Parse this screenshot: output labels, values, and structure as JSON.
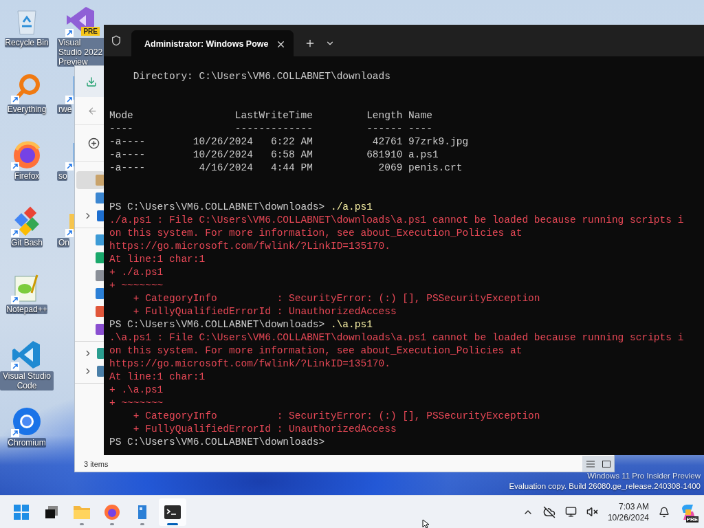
{
  "desktop_columns": [
    {
      "icons": [
        {
          "kind": "recycle-bin",
          "label": "Recycle Bin"
        },
        {
          "kind": "everything",
          "label": "Everything",
          "shortcut": true
        },
        {
          "kind": "firefox",
          "label": "Firefox",
          "shortcut": true
        },
        {
          "kind": "git",
          "label": "Git Bash",
          "shortcut": true
        },
        {
          "kind": "notepad",
          "label": "Notepad++",
          "shortcut": true
        },
        {
          "kind": "vscode",
          "label": "Visual Studio Code",
          "shortcut": true
        },
        {
          "kind": "chromium",
          "label": "Chromium",
          "shortcut": true
        }
      ]
    },
    {
      "icons": [
        {
          "kind": "vs-preview",
          "label": "Visual Studio 2022 Preview",
          "badge": "PRE",
          "shortcut": true
        },
        {
          "kind": "figure",
          "label": "rwe",
          "shortcut": true
        },
        {
          "kind": "figure",
          "label": "so",
          "shortcut": true
        },
        {
          "kind": "folder",
          "label": "On",
          "shortcut": true
        }
      ]
    }
  ],
  "explorer": {
    "sidebar_groups": [
      {
        "items": [
          {
            "kind": "home",
            "selected": true,
            "expandable": false
          },
          {
            "kind": "gallery",
            "selected": false,
            "expandable": false
          },
          {
            "kind": "cloud",
            "selected": false,
            "expandable": true
          }
        ]
      },
      {
        "items": [
          {
            "kind": "desktop",
            "selected": false,
            "expandable": false
          },
          {
            "kind": "downloads",
            "selected": false,
            "expandable": false
          },
          {
            "kind": "documents",
            "selected": false,
            "expandable": false
          },
          {
            "kind": "pictures",
            "selected": false,
            "expandable": false
          },
          {
            "kind": "music",
            "selected": false,
            "expandable": false
          },
          {
            "kind": "videos",
            "selected": false,
            "expandable": false
          }
        ]
      },
      {
        "items": [
          {
            "kind": "this-pc",
            "selected": false,
            "expandable": true
          },
          {
            "kind": "network",
            "selected": false,
            "expandable": true
          }
        ]
      }
    ],
    "status": "3 items"
  },
  "terminal": {
    "tab_title": "Administrator: Windows Powe",
    "lines": [
      {
        "kind": "output",
        "text": "    Directory: C:\\Users\\VM6.COLLABNET\\downloads"
      },
      {
        "kind": "blank"
      },
      {
        "kind": "blank"
      },
      {
        "kind": "output",
        "text": "Mode                 LastWriteTime         Length Name"
      },
      {
        "kind": "output",
        "text": "----                 -------------         ------ ----"
      },
      {
        "kind": "output",
        "text": "-a----        10/26/2024   6:22 AM          42761 97zrk9.jpg"
      },
      {
        "kind": "output",
        "text": "-a----        10/26/2024   6:58 AM         681910 a.ps1"
      },
      {
        "kind": "output",
        "text": "-a----         4/16/2024   4:44 PM           2069 penis.crt"
      },
      {
        "kind": "blank"
      },
      {
        "kind": "blank"
      },
      {
        "kind": "prompt",
        "text": "PS C:\\Users\\VM6.COLLABNET\\downloads> ",
        "command": "./a.ps1"
      },
      {
        "kind": "error",
        "text": "./a.ps1 : File C:\\Users\\VM6.COLLABNET\\downloads\\a.ps1 cannot be loaded because running scripts i"
      },
      {
        "kind": "error",
        "text": "on this system. For more information, see about_Execution_Policies at"
      },
      {
        "kind": "error",
        "text": "https://go.microsoft.com/fwlink/?LinkID=135170."
      },
      {
        "kind": "error",
        "text": "At line:1 char:1"
      },
      {
        "kind": "error",
        "text": "+ ./a.ps1"
      },
      {
        "kind": "error",
        "text": "+ ~~~~~~~"
      },
      {
        "kind": "error",
        "text": "    + CategoryInfo          : SecurityError: (:) [], PSSecurityException"
      },
      {
        "kind": "error",
        "text": "    + FullyQualifiedErrorId : UnauthorizedAccess"
      },
      {
        "kind": "prompt",
        "text": "PS C:\\Users\\VM6.COLLABNET\\downloads> ",
        "command": ".\\a.ps1"
      },
      {
        "kind": "error",
        "text": ".\\a.ps1 : File C:\\Users\\VM6.COLLABNET\\downloads\\a.ps1 cannot be loaded because running scripts i"
      },
      {
        "kind": "error",
        "text": "on this system. For more information, see about_Execution_Policies at"
      },
      {
        "kind": "error",
        "text": "https://go.microsoft.com/fwlink/?LinkID=135170."
      },
      {
        "kind": "error",
        "text": "At line:1 char:1"
      },
      {
        "kind": "error",
        "text": "+ .\\a.ps1"
      },
      {
        "kind": "error",
        "text": "+ ~~~~~~~"
      },
      {
        "kind": "error",
        "text": "    + CategoryInfo          : SecurityError: (:) [], PSSecurityException"
      },
      {
        "kind": "error",
        "text": "    + FullyQualifiedErrorId : UnauthorizedAccess"
      },
      {
        "kind": "prompt",
        "text": "PS C:\\Users\\VM6.COLLABNET\\downloads> "
      }
    ]
  },
  "watermark": [
    "Windows 11 Pro Insider Preview",
    "Evaluation copy. Build 26080.ge_release.240308-1400"
  ],
  "taskbar": {
    "apps": [
      {
        "kind": "start",
        "running": false,
        "selected": false
      },
      {
        "kind": "task-view",
        "running": false,
        "selected": false
      },
      {
        "kind": "explorer",
        "running": true,
        "selected": false
      },
      {
        "kind": "firefox",
        "running": true,
        "selected": false
      },
      {
        "kind": "figure",
        "running": true,
        "selected": false
      },
      {
        "kind": "terminal",
        "running": true,
        "selected": true
      }
    ],
    "time": "7:03 AM",
    "date": "10/26/2024",
    "copilot_badge": "PRE"
  }
}
